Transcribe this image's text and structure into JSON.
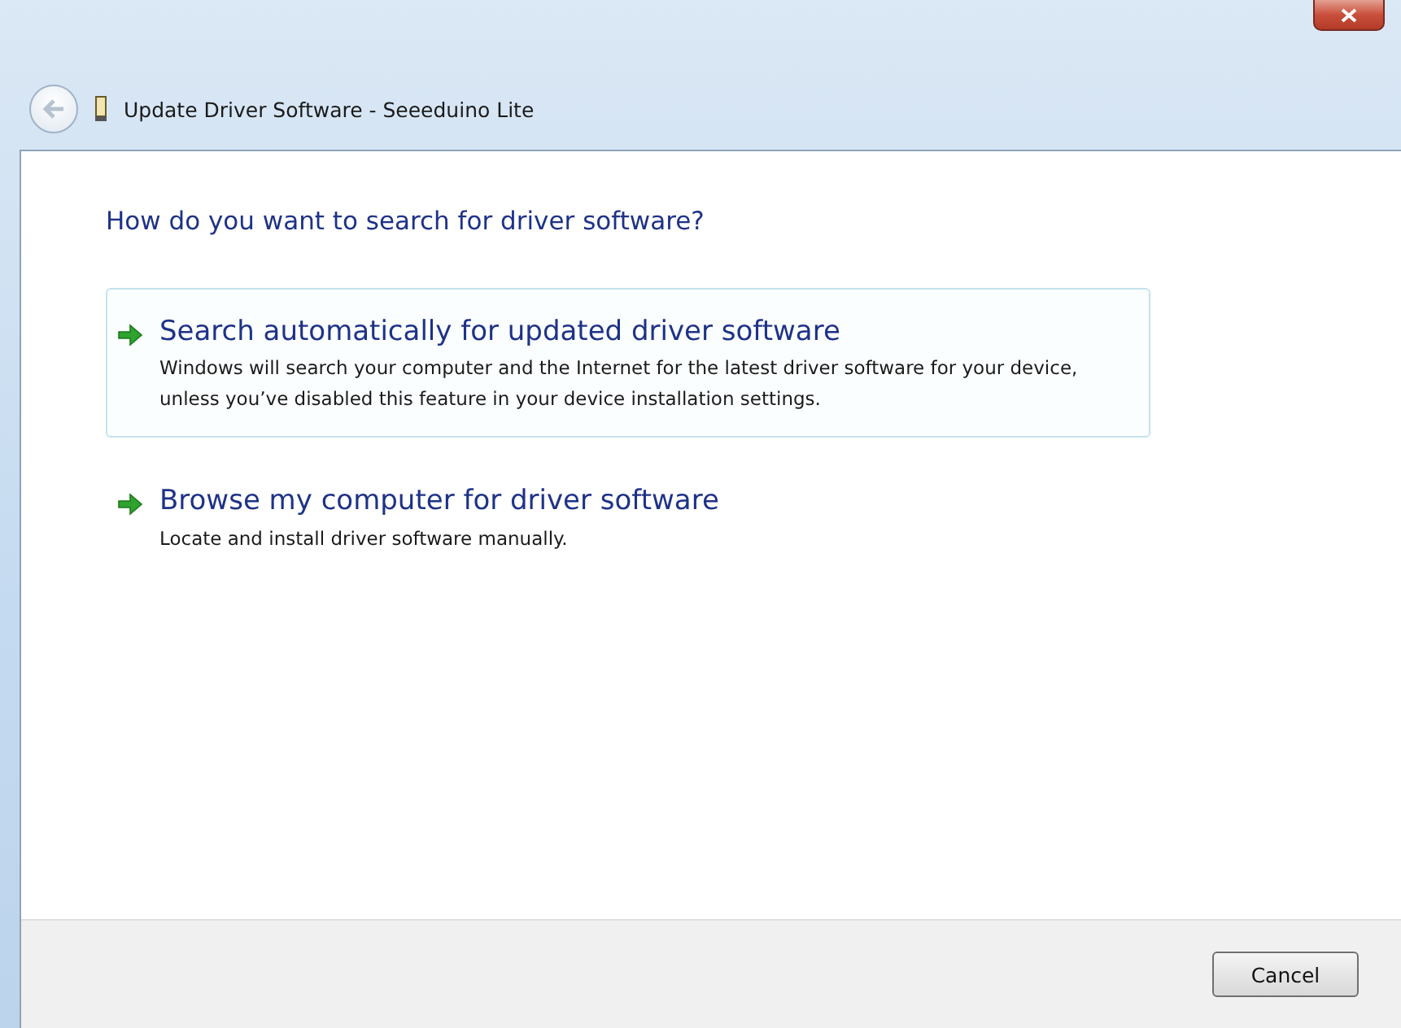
{
  "window": {
    "title": "Update Driver Software - Seeeduino Lite"
  },
  "heading": "How do you want to search for driver software?",
  "options": [
    {
      "title": "Search automatically for updated driver software",
      "description": "Windows will search your computer and the Internet for the latest driver software for your device, unless you’ve disabled this feature in your device installation settings.",
      "selected": true
    },
    {
      "title": "Browse my computer for driver software",
      "description": "Locate and install driver software manually.",
      "selected": false
    }
  ],
  "buttons": [
    "Cancel"
  ]
}
